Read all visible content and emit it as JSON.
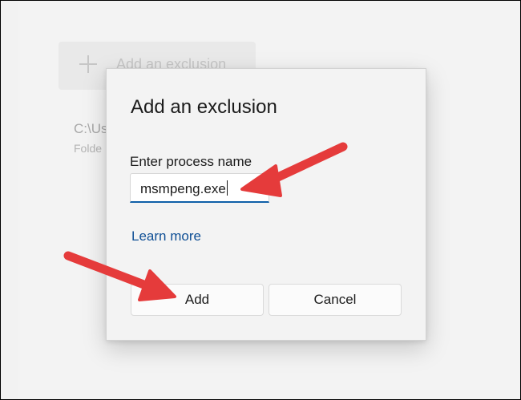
{
  "background": {
    "add_exclusion_label": "Add an exclusion",
    "existing_path": "C:\\Us",
    "existing_type": "Folde"
  },
  "dialog": {
    "title": "Add an exclusion",
    "field_label": "Enter process name",
    "input_value": "msmpeng.exe",
    "learn_more": "Learn more",
    "add_button": "Add",
    "cancel_button": "Cancel"
  },
  "colors": {
    "arrow": "#e53b3b",
    "link": "#0f4f95",
    "input_focus_underline": "#0f5fa8"
  },
  "icons": {
    "plus": "plus-icon",
    "clear": "clear-icon",
    "annotation": "annotation-arrow"
  }
}
